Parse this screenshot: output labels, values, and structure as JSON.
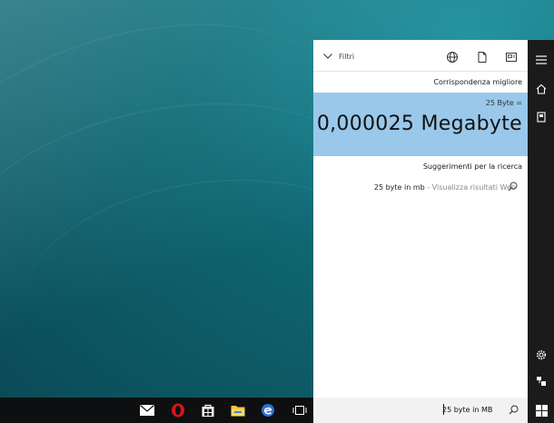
{
  "filter": {
    "label": "Filtri"
  },
  "best_match": {
    "title": "Corrispondenza migliore",
    "query_echo": "25 Byte =",
    "result": "0,000025 Megabyte"
  },
  "suggestions": {
    "title": "Suggerimenti per la ricerca",
    "items": [
      {
        "query": "25 byte in mb",
        "suffix": " - Visualizza risultati Web"
      }
    ]
  },
  "search": {
    "value": "25 byte in MB"
  },
  "colors": {
    "accent": "#99c8ea",
    "rail": "#1b1b1b",
    "taskbar": "#0e0f10",
    "opera": "#d7151d",
    "edge": "#2f6fd6"
  },
  "icons": {
    "header": [
      "globe-icon",
      "document-icon",
      "tablet-icon"
    ],
    "rail": [
      "hamburger-menu-icon",
      "home-icon",
      "notebook-icon",
      "settings-icon",
      "feedback-icon"
    ],
    "taskbar": [
      "mail-icon",
      "opera-icon",
      "store-icon",
      "file-explorer-icon",
      "app-icon",
      "task-view-icon",
      "start-icon"
    ]
  }
}
